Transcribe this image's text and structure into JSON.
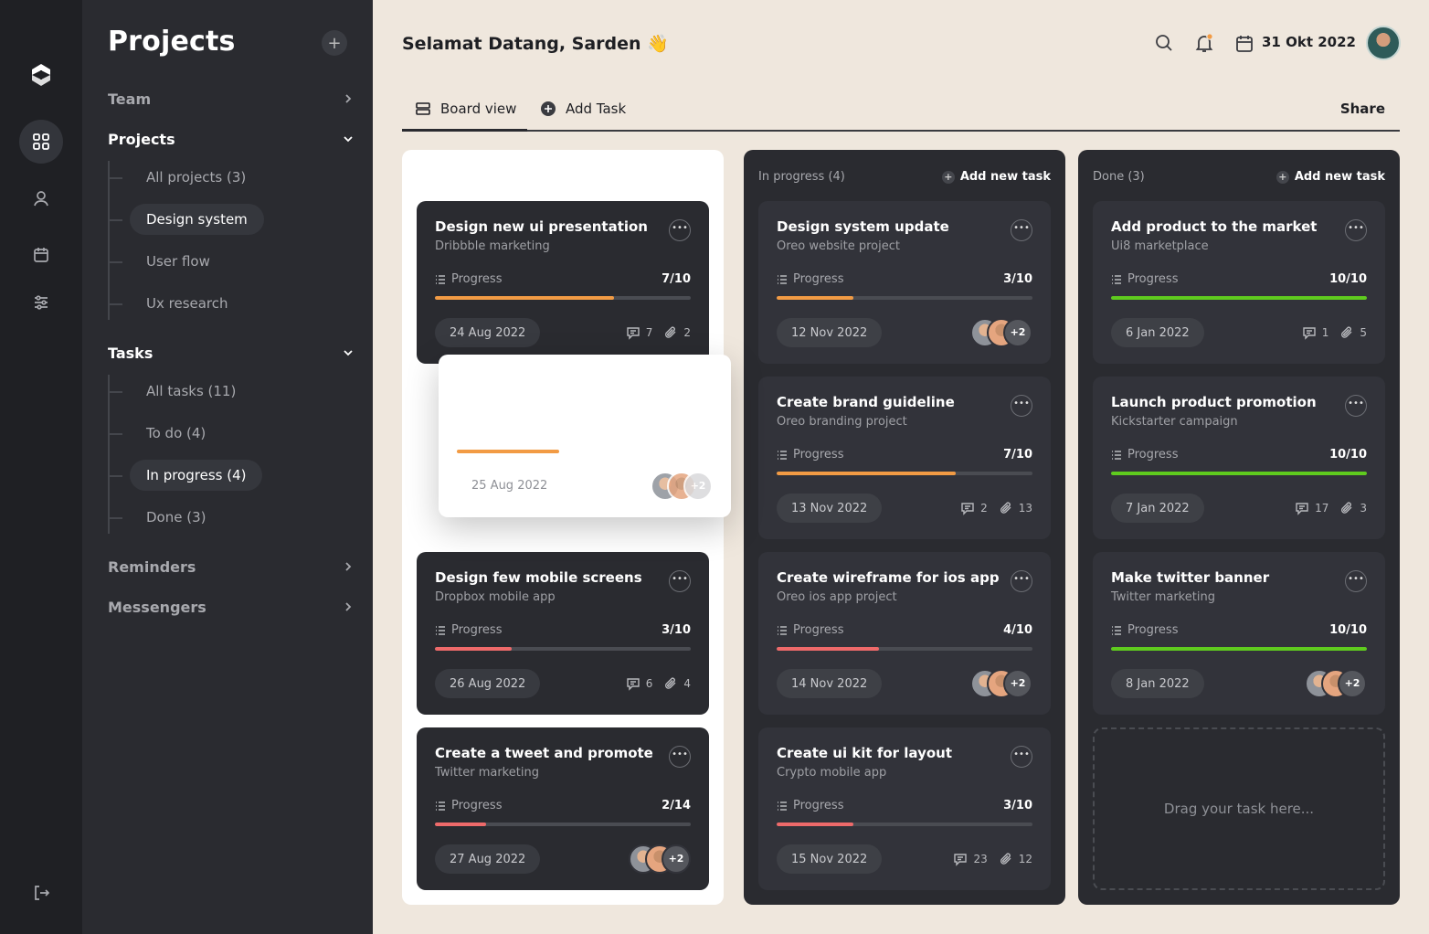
{
  "colors": {
    "orange": "#F29B44",
    "red": "#EE6A6A",
    "green": "#5FCB1E"
  },
  "nav": {
    "title": "Projects",
    "sections": {
      "team": "Team",
      "projects": "Projects",
      "tasks": "Tasks",
      "reminders": "Reminders",
      "messengers": "Messengers"
    },
    "project_items": [
      "All projects (3)",
      "Design system",
      "User flow",
      "Ux research"
    ],
    "task_items": [
      "All tasks (11)",
      "To do (4)",
      "In progress (4)",
      "Done (3)"
    ]
  },
  "header": {
    "greeting": "Selamat Datang, Sarden 👋",
    "date": "31 Okt 2022"
  },
  "tabs": {
    "board": "Board view",
    "add": "Add Task",
    "share": "Share"
  },
  "columns": {
    "todo": {
      "cards": [
        {
          "title": "Design new ui presentation",
          "subtitle": "Dribbble marketing",
          "progress_label": "Progress",
          "progress": "7/10",
          "fill": 0.7,
          "color": "orange",
          "date": "24 Aug 2022",
          "comments": "7",
          "attachments": "2"
        },
        {
          "title": "Design few mobile screens",
          "subtitle": "Dropbox mobile app",
          "progress_label": "Progress",
          "progress": "3/10",
          "fill": 0.3,
          "color": "red",
          "date": "26 Aug 2022",
          "comments": "6",
          "attachments": "4"
        },
        {
          "title": "Create a tweet and promote",
          "subtitle": "Twitter marketing",
          "progress_label": "Progress",
          "progress": "2/14",
          "fill": 0.2,
          "color": "red",
          "date": "27 Aug 2022",
          "more_people": "+2"
        }
      ],
      "dragging": {
        "date": "25 Aug 2022",
        "more_people": "+2",
        "fill": 0.4
      }
    },
    "inprogress": {
      "count": "In progress (4)",
      "add": "Add new task",
      "cards": [
        {
          "title": "Design system update",
          "subtitle": "Oreo website project",
          "progress_label": "Progress",
          "progress": "3/10",
          "fill": 0.3,
          "color": "orange",
          "date": "12 Nov 2022",
          "more_people": "+2"
        },
        {
          "title": "Create brand guideline",
          "subtitle": "Oreo branding project",
          "progress_label": "Progress",
          "progress": "7/10",
          "fill": 0.7,
          "color": "orange",
          "date": "13 Nov 2022",
          "comments": "2",
          "attachments": "13"
        },
        {
          "title": "Create wireframe for ios app",
          "subtitle": "Oreo ios app project",
          "progress_label": "Progress",
          "progress": "4/10",
          "fill": 0.4,
          "color": "red",
          "date": "14 Nov 2022",
          "more_people": "+2"
        },
        {
          "title": "Create ui kit for layout",
          "subtitle": "Crypto mobile app",
          "progress_label": "Progress",
          "progress": "3/10",
          "fill": 0.3,
          "color": "red",
          "date": "15 Nov 2022",
          "comments": "23",
          "attachments": "12"
        }
      ]
    },
    "done": {
      "count": "Done (3)",
      "add": "Add new task",
      "cards": [
        {
          "title": "Add product to the market",
          "subtitle": "Ui8 marketplace",
          "progress_label": "Progress",
          "progress": "10/10",
          "fill": 1.0,
          "color": "green",
          "date": "6 Jan 2022",
          "comments": "1",
          "attachments": "5"
        },
        {
          "title": "Launch product promotion",
          "subtitle": "Kickstarter campaign",
          "progress_label": "Progress",
          "progress": "10/10",
          "fill": 1.0,
          "color": "green",
          "date": "7 Jan 2022",
          "comments": "17",
          "attachments": "3"
        },
        {
          "title": "Make twitter banner",
          "subtitle": "Twitter marketing",
          "progress_label": "Progress",
          "progress": "10/10",
          "fill": 1.0,
          "color": "green",
          "date": "8 Jan 2022",
          "more_people": "+2"
        }
      ],
      "dropzone": "Drag your task here..."
    }
  }
}
